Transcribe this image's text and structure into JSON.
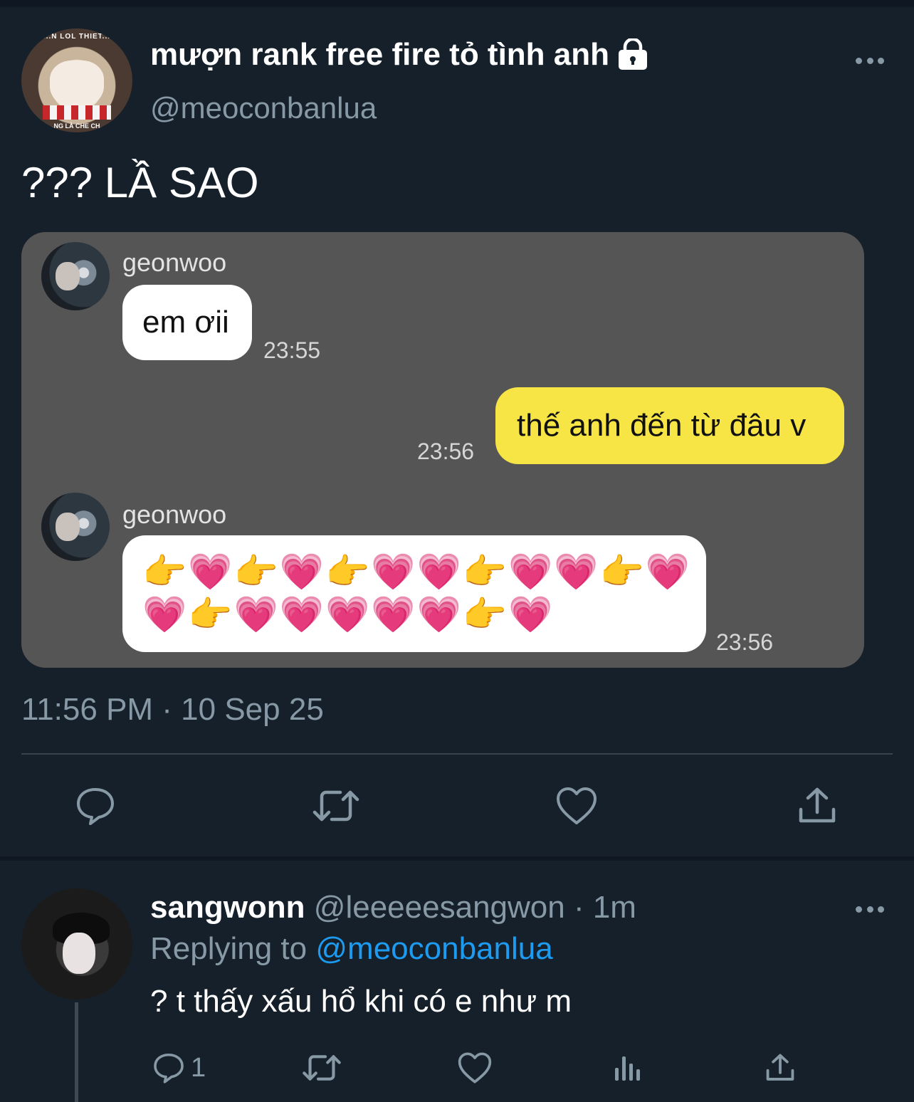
{
  "tweet": {
    "author_name": "mượn rank free fire tỏ tình anh",
    "author_handle": "@meoconbanlua",
    "avatar_top_caption": "...N LOL THIET...",
    "avatar_bottom_caption": "...NG LÀ CHE CH...",
    "text": "??? LẦ SAO",
    "timestamp": "11:56 PM · 10 Sep 25"
  },
  "chat_image": {
    "messages": [
      {
        "sender": "geonwoo",
        "text": "em ơii",
        "time": "23:55",
        "side": "left"
      },
      {
        "sender": "",
        "text": "thế anh đến từ đâu v",
        "time": "23:56",
        "side": "right"
      },
      {
        "sender": "geonwoo",
        "emoji_line_1": "👉💗👉💗👉💗💗👉💗💗👉💗",
        "emoji_line_2": "💗👉💗💗💗💗💗👉💗",
        "time": "23:56",
        "side": "left"
      }
    ]
  },
  "reply": {
    "name": "sangwonn",
    "handle_meta": "@leeeeesangwon · 1m",
    "replying_prefix": "Replying to",
    "replying_mention": "@meoconbanlua",
    "text": "? t thấy xấu hổ khi có e như m",
    "reply_count": "1"
  },
  "colors": {
    "background": "#15202b",
    "muted": "#8899a6",
    "accent": "#1d9bf0",
    "chat_bg": "#565555",
    "yellow_bubble": "#f7e545"
  },
  "icons": [
    "lock-icon",
    "more-icon",
    "reply-icon",
    "retweet-icon",
    "like-icon",
    "share-icon",
    "analytics-icon"
  ]
}
